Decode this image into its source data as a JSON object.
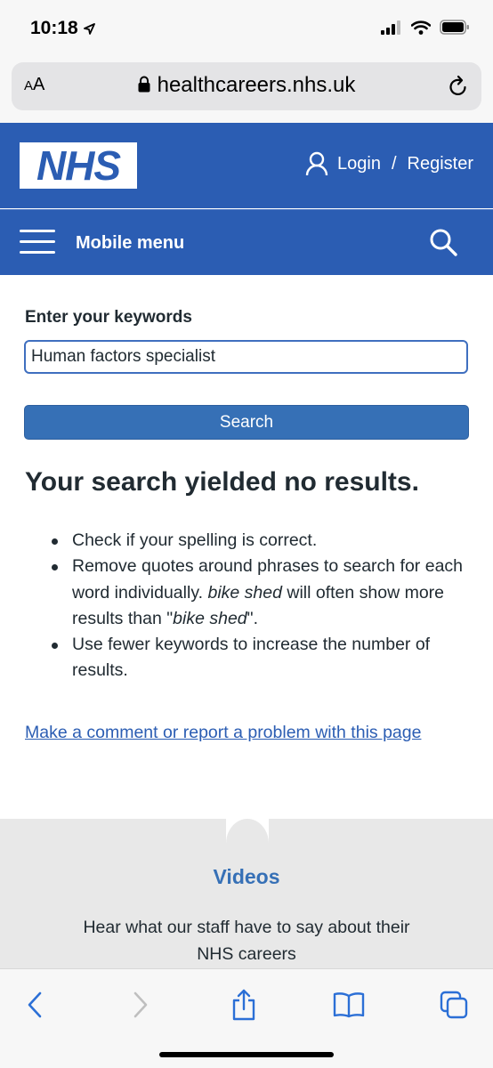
{
  "status": {
    "time": "10:18"
  },
  "browser": {
    "text_size_label_small": "A",
    "text_size_label_large": "A",
    "url": "healthcareers.nhs.uk"
  },
  "header": {
    "logo": "NHS",
    "login": "Login",
    "separator": "/",
    "register": "Register"
  },
  "nav": {
    "menu_label": "Mobile menu"
  },
  "search": {
    "label": "Enter your keywords",
    "value": "Human factors specialist",
    "button": "Search"
  },
  "results": {
    "heading": "Your search yielded no results.",
    "tip1": "Check if your spelling is correct.",
    "tip2_pre": "Remove quotes around phrases to search for each word individually. ",
    "tip2_em1": "bike shed",
    "tip2_mid": " will often show more results than  \"",
    "tip2_em2": "bike shed",
    "tip2_post": "\".",
    "tip3": "Use fewer keywords to increase the number of results."
  },
  "feedback": {
    "link": "Make a comment or report a problem with this page"
  },
  "videos": {
    "title": "Videos",
    "text": "Hear what our staff have to say about their NHS careers"
  },
  "colors": {
    "nhs_blue": "#2b5db3",
    "button_blue": "#3670b6",
    "text": "#212b32"
  }
}
